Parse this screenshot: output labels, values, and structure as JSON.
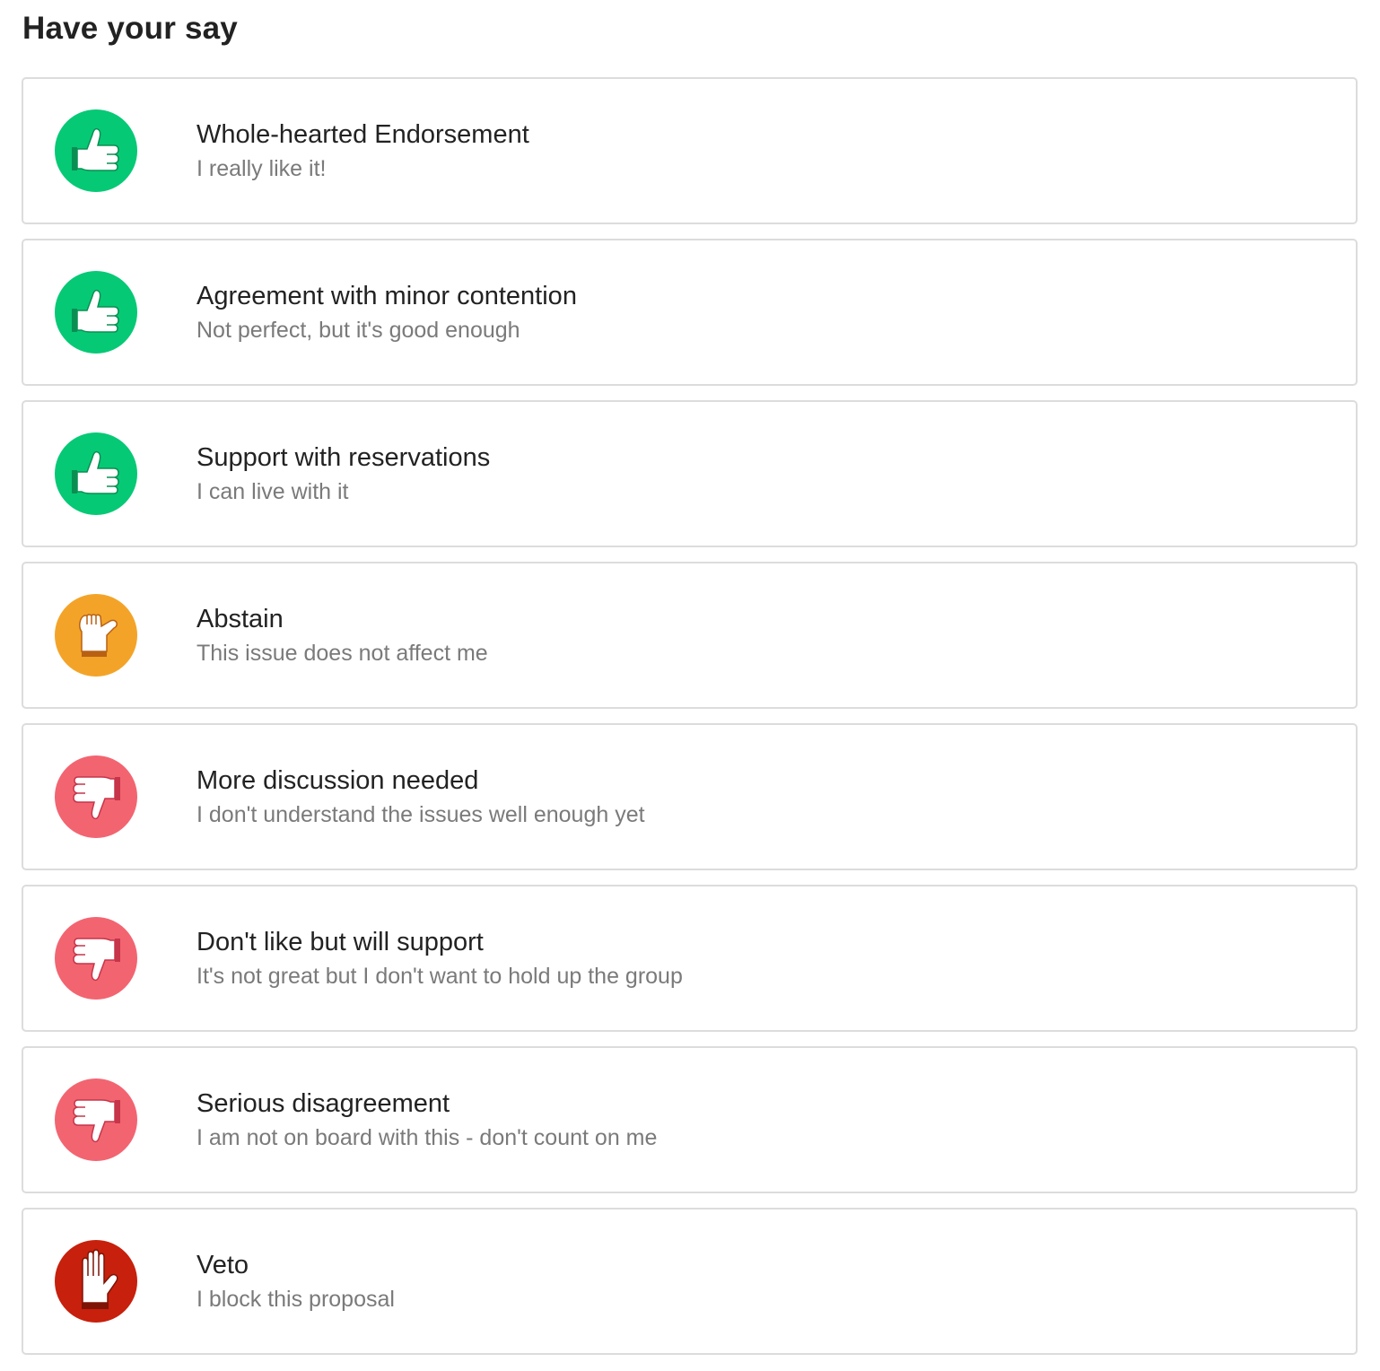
{
  "header": {
    "title": "Have your say"
  },
  "colors": {
    "green": "#06c975",
    "green_dark": "#0a8f52",
    "orange": "#f3a428",
    "orange_dark": "#b96112",
    "red": "#f36471",
    "red_dark": "#c6354a",
    "block": "#c7200c",
    "block_dark": "#7e1406"
  },
  "options": [
    {
      "title": "Whole-hearted Endorsement",
      "description": "I really like it!",
      "icon": "thumbs-up-icon"
    },
    {
      "title": "Agreement with minor contention",
      "description": "Not perfect, but it's good enough",
      "icon": "thumbs-up-icon"
    },
    {
      "title": "Support with reservations",
      "description": "I can live with it",
      "icon": "thumbs-up-icon"
    },
    {
      "title": "Abstain",
      "description": "This issue does not affect me",
      "icon": "thumbs-sideways-icon"
    },
    {
      "title": "More discussion needed",
      "description": "I don't understand the issues well enough yet",
      "icon": "thumbs-down-icon"
    },
    {
      "title": "Don't like but will support",
      "description": "It's not great but I don't want to hold up the group",
      "icon": "thumbs-down-icon"
    },
    {
      "title": "Serious disagreement",
      "description": "I am not on board with this - don't count on me",
      "icon": "thumbs-down-icon"
    },
    {
      "title": "Veto",
      "description": "I block this proposal",
      "icon": "raised-hand-icon"
    }
  ]
}
